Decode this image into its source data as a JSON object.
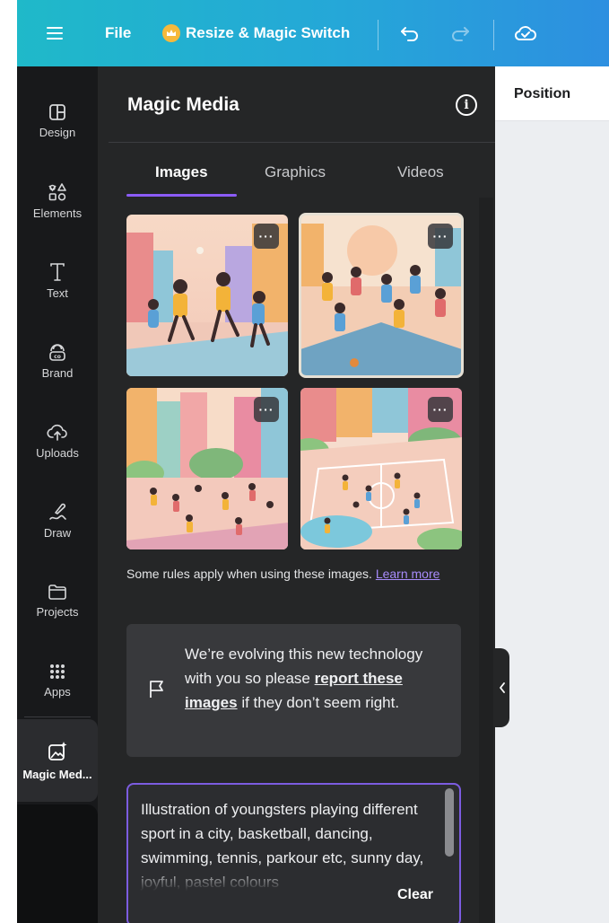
{
  "topbar": {
    "file_label": "File",
    "resize_label": "Resize & Magic Switch",
    "icons": [
      "menu-icon",
      "crown-icon",
      "undo-icon",
      "redo-icon",
      "cloud-saved-icon"
    ]
  },
  "rail": {
    "items": [
      {
        "label": "Design",
        "icon": "layout-icon"
      },
      {
        "label": "Elements",
        "icon": "shapes-icon"
      },
      {
        "label": "Text",
        "icon": "text-icon"
      },
      {
        "label": "Brand",
        "icon": "brand-icon"
      },
      {
        "label": "Uploads",
        "icon": "upload-cloud-icon"
      },
      {
        "label": "Draw",
        "icon": "draw-icon"
      },
      {
        "label": "Projects",
        "icon": "folder-icon"
      },
      {
        "label": "Apps",
        "icon": "apps-grid-icon"
      }
    ],
    "active": {
      "label": "Magic Med...",
      "icon": "magic-media-icon"
    }
  },
  "panel": {
    "title": "Magic Media",
    "tabs": [
      {
        "label": "Images",
        "active": true
      },
      {
        "label": "Graphics",
        "active": false
      },
      {
        "label": "Videos",
        "active": false
      }
    ],
    "more_label": "···",
    "rules_text": "Some rules apply when using these images.",
    "rules_link": "Learn more",
    "notice": {
      "before": "We’re evolving this new technology with you so please",
      "link": "report these images",
      "after": "if they don’t seem right."
    },
    "prompt": {
      "text": "Illustration of youngsters playing different sport in a city, basketball, dancing, swimming, tennis, parkour etc, sunny day, joyful, pastel colours",
      "clear_label": "Clear"
    }
  },
  "editor": {
    "position_label": "Position"
  },
  "colors": {
    "accent": "#8b5cf6",
    "topbar_start": "#1fb9c9",
    "topbar_end": "#2d8fe0",
    "panel_bg": "#252627",
    "rail_bg": "#18191b"
  }
}
